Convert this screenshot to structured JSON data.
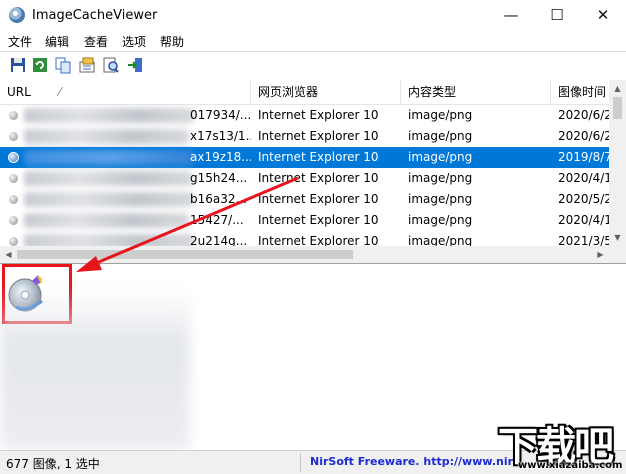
{
  "window": {
    "title": "ImageCacheViewer",
    "minimize_glyph": "—",
    "maximize_glyph": "☐",
    "close_glyph": "✕"
  },
  "menu": [
    "文件",
    "编辑",
    "查看",
    "选项",
    "帮助"
  ],
  "toolbar_icons": [
    "save-icon",
    "refresh-icon",
    "copy-icon",
    "properties-icon",
    "find-icon",
    "exit-icon"
  ],
  "table": {
    "columns": [
      "URL",
      "网页浏览器",
      "内容类型",
      "图像时间"
    ],
    "sort_glyph": "⁄",
    "rows": [
      {
        "url": "017934/...",
        "browser": "Internet Explorer 10",
        "type": "image/png",
        "time": "2020/6/2",
        "selected": false
      },
      {
        "url": "x17s13/1...",
        "browser": "Internet Explorer 10",
        "type": "image/png",
        "time": "2020/6/2",
        "selected": false
      },
      {
        "url": "ax19z18...",
        "browser": "Internet Explorer 10",
        "type": "image/png",
        "time": "2019/8/7",
        "selected": true
      },
      {
        "url": "g15h24...",
        "browser": "Internet Explorer 10",
        "type": "image/png",
        "time": "2020/4/1",
        "selected": false
      },
      {
        "url": "b16a32...",
        "browser": "Internet Explorer 10",
        "type": "image/png",
        "time": "2020/5/2",
        "selected": false
      },
      {
        "url": "15427/...",
        "browser": "Internet Explorer 10",
        "type": "image/png",
        "time": "2020/4/1",
        "selected": false
      },
      {
        "url": "2u214g...",
        "browser": "Internet Explorer 10",
        "type": "image/png",
        "time": "2021/3/5",
        "selected": false
      }
    ]
  },
  "status": {
    "count": "677 图像, 1 选中",
    "link": "NirSoft Freeware.  http://www.nir"
  },
  "watermark": {
    "text": "下载吧",
    "url": "www.xiazaiba.com"
  },
  "colors": {
    "selection": "#0078d7",
    "annotation_red": "#e8141c",
    "link_blue": "#1e2bd0"
  }
}
